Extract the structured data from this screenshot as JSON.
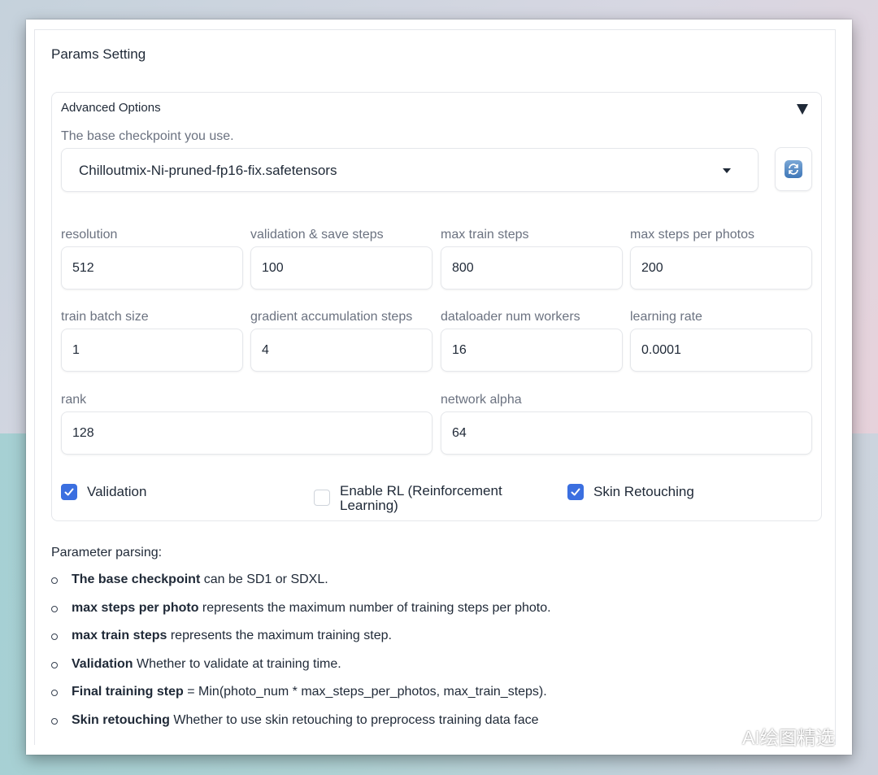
{
  "section_title": "Params Setting",
  "advanced": {
    "label": "Advanced Options",
    "checkpoint_label": "The base checkpoint you use.",
    "checkpoint_value": "Chilloutmix-Ni-pruned-fp16-fix.safetensors"
  },
  "fields": {
    "resolution": {
      "label": "resolution",
      "value": "512"
    },
    "validation_save_steps": {
      "label": "validation & save steps",
      "value": "100"
    },
    "max_train_steps": {
      "label": "max train steps",
      "value": "800"
    },
    "max_steps_per_photos": {
      "label": "max steps per photos",
      "value": "200"
    },
    "train_batch_size": {
      "label": "train batch size",
      "value": "1"
    },
    "gradient_accumulation_steps": {
      "label": "gradient accumulation steps",
      "value": "4"
    },
    "dataloader_num_workers": {
      "label": "dataloader num workers",
      "value": "16"
    },
    "learning_rate": {
      "label": "learning rate",
      "value": "0.0001"
    },
    "rank": {
      "label": "rank",
      "value": "128"
    },
    "network_alpha": {
      "label": "network alpha",
      "value": "64"
    }
  },
  "checkboxes": [
    {
      "label": "Validation",
      "checked": true
    },
    {
      "label": "Enable RL (Reinforcement Learning)",
      "checked": false
    },
    {
      "label": "Skin Retouching",
      "checked": true
    }
  ],
  "notes": {
    "title": "Parameter parsing:",
    "items": [
      {
        "bold": "The base checkpoint",
        "text": " can be SD1 or SDXL."
      },
      {
        "bold": "max steps per photo",
        "text": " represents the maximum number of training steps per photo."
      },
      {
        "bold": "max train steps",
        "text": " represents the maximum training step."
      },
      {
        "bold": "Validation",
        "text": " Whether to validate at training time."
      },
      {
        "bold": "Final training step",
        "text": " = Min(photo_num * max_steps_per_photos, max_train_steps)."
      },
      {
        "bold": "Skin retouching",
        "text": " Whether to use skin retouching to preprocess training data face"
      }
    ]
  },
  "watermark": "AI绘图精选",
  "colors": {
    "accent": "#3b6fe0",
    "label": "#6b7280",
    "border": "#e5e7eb"
  }
}
